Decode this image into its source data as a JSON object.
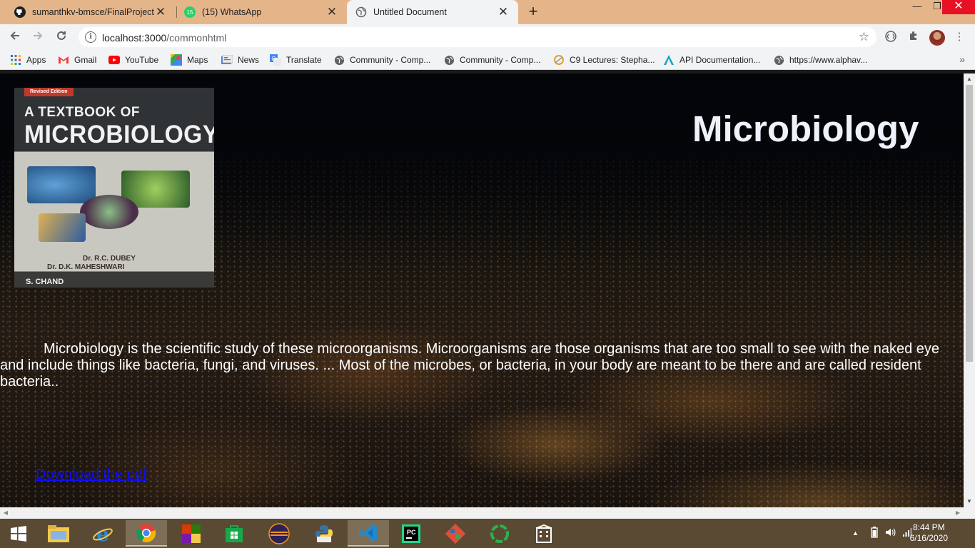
{
  "browser": {
    "tabs": [
      {
        "title": "sumanthkv-bmsce/FinalProject",
        "icon": "github-icon",
        "active": false
      },
      {
        "title": "(15) WhatsApp",
        "icon": "whatsapp-icon",
        "badge": "15",
        "active": false
      },
      {
        "title": "Untitled Document",
        "icon": "globe-icon",
        "active": true
      }
    ],
    "url_host": "localhost:3000",
    "url_path": "/commonhtml",
    "bookmarks": [
      {
        "label": "Apps",
        "icon": "apps-grid-icon"
      },
      {
        "label": "Gmail",
        "icon": "gmail-icon"
      },
      {
        "label": "YouTube",
        "icon": "youtube-icon"
      },
      {
        "label": "Maps",
        "icon": "maps-icon"
      },
      {
        "label": "News",
        "icon": "news-icon"
      },
      {
        "label": "Translate",
        "icon": "translate-icon"
      },
      {
        "label": "Community - Comp...",
        "icon": "globe-icon"
      },
      {
        "label": "Community - Comp...",
        "icon": "globe-icon"
      },
      {
        "label": "C9 Lectures: Stepha...",
        "icon": "c9-icon"
      },
      {
        "label": "API Documentation...",
        "icon": "api-icon"
      },
      {
        "label": "https://www.alphav...",
        "icon": "globe-icon"
      }
    ]
  },
  "page": {
    "heading": "Microbiology",
    "paragraph": "Microbiology is the scientific study of these microorganisms. Microorganisms are those organisms that are too small to see with the naked eye and include things like bacteria, fungi, and viruses. ... Most of the microbes, or bacteria, in your body are meant to be there and are called resident bacteria..",
    "link_label": "Download the pdf",
    "book": {
      "edition": "Revised Edition",
      "title_line1": "A TEXTBOOK OF",
      "title_line2": "MICROBIOLOGY",
      "author1": "Dr. R.C. DUBEY",
      "author2": "Dr. D.K. MAHESHWARI",
      "publisher": "S. CHAND"
    }
  },
  "taskbar": {
    "time": "8:44 PM",
    "date": "6/16/2020"
  },
  "colors": {
    "tabstrip": "#e5b58a",
    "link": "#1010ee",
    "heading": "#eef3fb",
    "taskbar": "#5a4a33"
  }
}
